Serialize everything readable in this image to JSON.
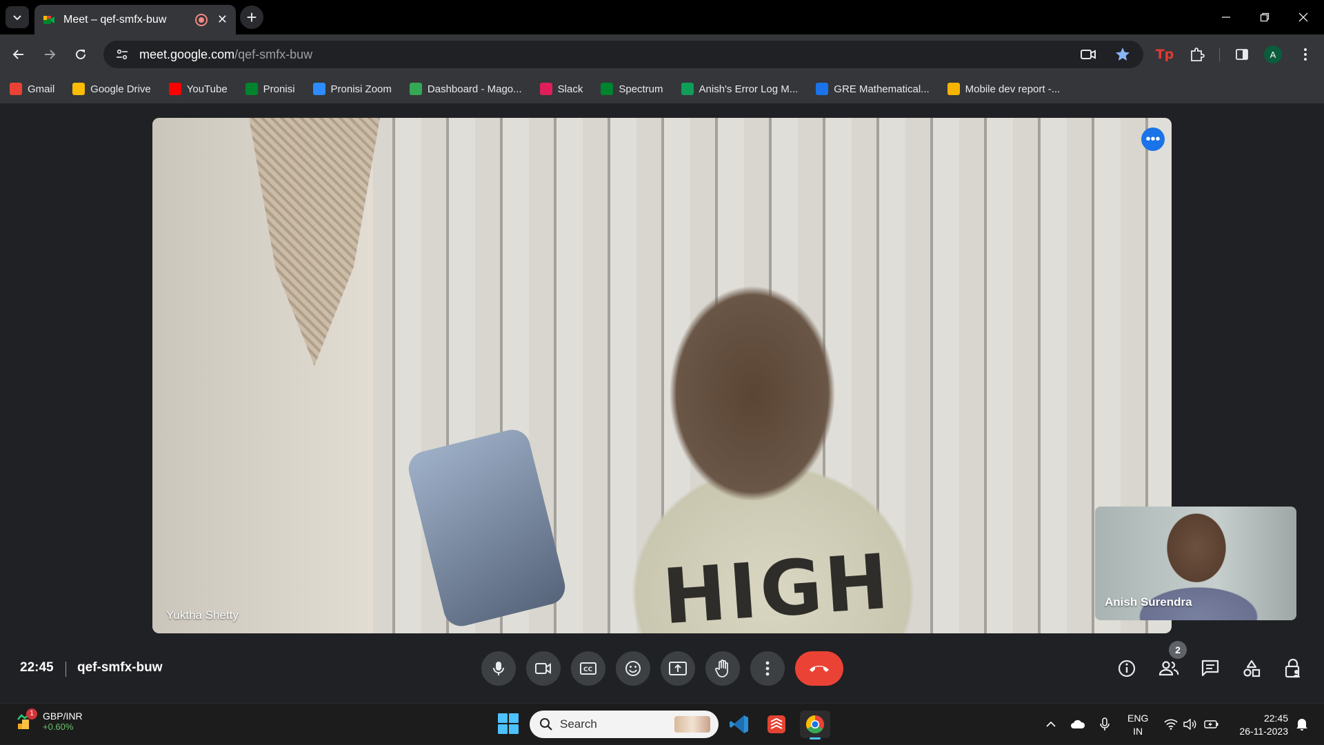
{
  "browser": {
    "tab_title": "Meet – qef-smfx-buw",
    "url_host": "meet.google.com",
    "url_path": "/qef-smfx-buw",
    "profile_initial": "A",
    "bookmarks": [
      {
        "label": "Gmail",
        "icon": "gmail-icon",
        "color": "#ea4335"
      },
      {
        "label": "Google Drive",
        "icon": "drive-icon",
        "color": "#fbbc04"
      },
      {
        "label": "YouTube",
        "icon": "youtube-icon",
        "color": "#ff0000"
      },
      {
        "label": "Pronisi",
        "icon": "meet-icon",
        "color": "#00832d"
      },
      {
        "label": "Pronisi Zoom",
        "icon": "zoom-icon",
        "color": "#2d8cff"
      },
      {
        "label": "Dashboard - Mago...",
        "icon": "dashboard-icon",
        "color": "#34a853"
      },
      {
        "label": "Slack",
        "icon": "slack-icon",
        "color": "#e01e5a"
      },
      {
        "label": "Spectrum",
        "icon": "meet-icon",
        "color": "#00832d"
      },
      {
        "label": "Anish's Error Log M...",
        "icon": "sheets-icon",
        "color": "#0f9d58"
      },
      {
        "label": "GRE Mathematical...",
        "icon": "loading-icon",
        "color": "#1a73e8"
      },
      {
        "label": "Mobile dev report -...",
        "icon": "slides-icon",
        "color": "#f4b400"
      }
    ]
  },
  "meet": {
    "main_participant": "Yuktha Shetty",
    "self_participant": "Anish Surendra",
    "shirt_text": "HIGH",
    "time": "22:45",
    "meeting_code": "qef-smfx-buw",
    "participant_count": "2",
    "end_call_color": "#ea4335"
  },
  "taskbar": {
    "widget_title": "GBP/INR",
    "widget_change": "+0.60%",
    "widget_notifications": "1",
    "search_placeholder": "Search",
    "lang_line1": "ENG",
    "lang_line2": "IN",
    "time": "22:45",
    "date": "26-11-2023"
  }
}
